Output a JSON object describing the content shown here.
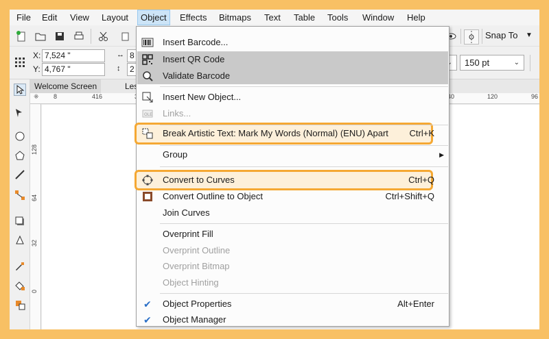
{
  "menubar": {
    "items": [
      "File",
      "Edit",
      "View",
      "Layout",
      "Object",
      "Effects",
      "Bitmaps",
      "Text",
      "Table",
      "Tools",
      "Window",
      "Help"
    ]
  },
  "toolbar": {
    "snap_label": "Snap To",
    "x_label": "X:",
    "y_label": "Y:",
    "x_value": "7,524 \"",
    "y_value": "4,767 \"",
    "w_value": "8",
    "h_value": "2",
    "font_size": "150 pt"
  },
  "tabs": {
    "welcome": "Welcome Screen",
    "doc": "LesK"
  },
  "rulers": {
    "top": [
      "8",
      "416",
      "384",
      "40",
      "120",
      "96"
    ],
    "left": [
      "128",
      "64",
      "32",
      "0"
    ]
  },
  "menu": {
    "items": [
      {
        "label": "Insert Barcode...",
        "shortcut": "",
        "icon": "barcode-icon",
        "state": "normal"
      },
      {
        "label": "Insert QR Code",
        "shortcut": "",
        "icon": "qr-code-icon",
        "state": "highlighted"
      },
      {
        "label": "Validate Barcode",
        "shortcut": "",
        "icon": "validate-barcode-icon",
        "state": "highlighted"
      },
      {
        "label": "Insert New Object...",
        "shortcut": "",
        "icon": "insert-object-icon",
        "state": "normal"
      },
      {
        "label": "Links...",
        "shortcut": "",
        "icon": "ole-icon",
        "state": "disabled"
      },
      {
        "label": "Break Artistic Text: Mark My Words (Normal) (ENU) Apart",
        "shortcut": "Ctrl+K",
        "icon": "break-apart-icon",
        "state": "emphasized"
      },
      {
        "label": "Group",
        "shortcut": "",
        "icon": "",
        "state": "submenu"
      },
      {
        "label": "Convert to Curves",
        "shortcut": "Ctrl+Q",
        "icon": "convert-curves-icon",
        "state": "emphasized"
      },
      {
        "label": "Convert Outline to Object",
        "shortcut": "Ctrl+Shift+Q",
        "icon": "outline-object-icon",
        "state": "normal"
      },
      {
        "label": "Join Curves",
        "shortcut": "",
        "icon": "",
        "state": "normal"
      },
      {
        "label": "Overprint Fill",
        "shortcut": "",
        "icon": "",
        "state": "normal"
      },
      {
        "label": "Overprint Outline",
        "shortcut": "",
        "icon": "",
        "state": "disabled"
      },
      {
        "label": "Overprint Bitmap",
        "shortcut": "",
        "icon": "",
        "state": "disabled"
      },
      {
        "label": "Object Hinting",
        "shortcut": "",
        "icon": "",
        "state": "disabled"
      },
      {
        "label": "Object Properties",
        "shortcut": "Alt+Enter",
        "icon": "check-icon",
        "state": "checked"
      },
      {
        "label": "Object Manager",
        "shortcut": "",
        "icon": "check-icon",
        "state": "checked"
      }
    ]
  },
  "colors": {
    "frame": "#f8c064",
    "highlight_border": "#f5a833",
    "menu_highlight": "#c9c9c9",
    "check": "#2a6fc7"
  }
}
